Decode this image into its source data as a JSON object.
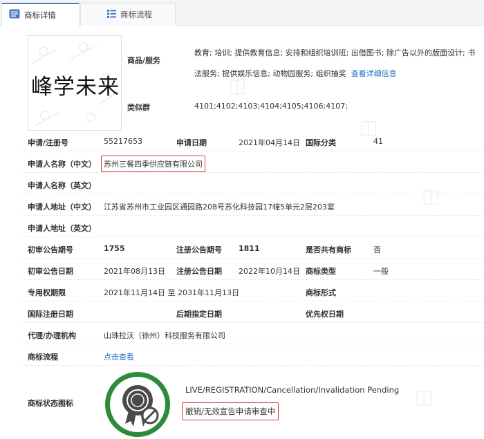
{
  "tabs": {
    "detail": "商标详情",
    "process": "商标流程"
  },
  "logo": {
    "text": "峰学未来"
  },
  "goods": {
    "label": "商品/服务",
    "text": "教育; 培训; 提供教育信息; 安排和组织培训班; 出借图书; 除广告以外的版面设计; 书法服务; 提供娱乐信息; 动物园服务; 组织抽奖",
    "more_link": "查看详细信息"
  },
  "similar": {
    "label": "类似群",
    "value": "4101;4102;4103;4104;4105;4106;4107;"
  },
  "fields": {
    "reg_no_label": "申请/注册号",
    "reg_no": "55217653",
    "apply_date_label": "申请日期",
    "apply_date": "2021年04月14日",
    "intl_class_label": "国际分类",
    "intl_class": "41",
    "applicant_cn_label": "申请人名称（中文）",
    "applicant_cn": "苏州三餐四季供应链有限公司",
    "applicant_en_label": "申请人名称（英文）",
    "address_cn_label": "申请人地址（中文）",
    "address_cn": "江苏省苏州市工业园区通园路208号苏化科技园17幢5单元2层203室",
    "address_en_label": "申请人地址（英文）",
    "prelim_no_label": "初审公告期号",
    "prelim_no": "1755",
    "reg_notice_no_label": "注册公告期号",
    "reg_notice_no": "1811",
    "shared_label": "是否共有商标",
    "shared": "否",
    "prelim_date_label": "初审公告日期",
    "prelim_date": "2021年08月13日",
    "reg_notice_date_label": "注册公告日期",
    "reg_notice_date": "2022年10月14日",
    "tm_type_label": "商标类型",
    "tm_type": "一般",
    "exclusive_label": "专用权期限",
    "exclusive": "2021年11月14日 至 2031年11月13日",
    "tm_form_label": "商标形式",
    "intl_reg_date_label": "国际注册日期",
    "later_date_label": "后期指定日期",
    "priority_date_label": "优先权日期",
    "agent_label": "代理/办理机构",
    "agent": "山珠拉沃（徐州）科技服务有限公司",
    "process_label": "商标流程",
    "process_link": "点击查看"
  },
  "status": {
    "label": "商标状态图标",
    "en": "LIVE/REGISTRATION/Cancellation/Invalidation Pending",
    "cn": "撤销/无效宣告申请审查中"
  },
  "colors": {
    "link": "#1f6fc4",
    "highlight_border": "#d63b3b",
    "badge_ring": "#2e8b3a"
  }
}
